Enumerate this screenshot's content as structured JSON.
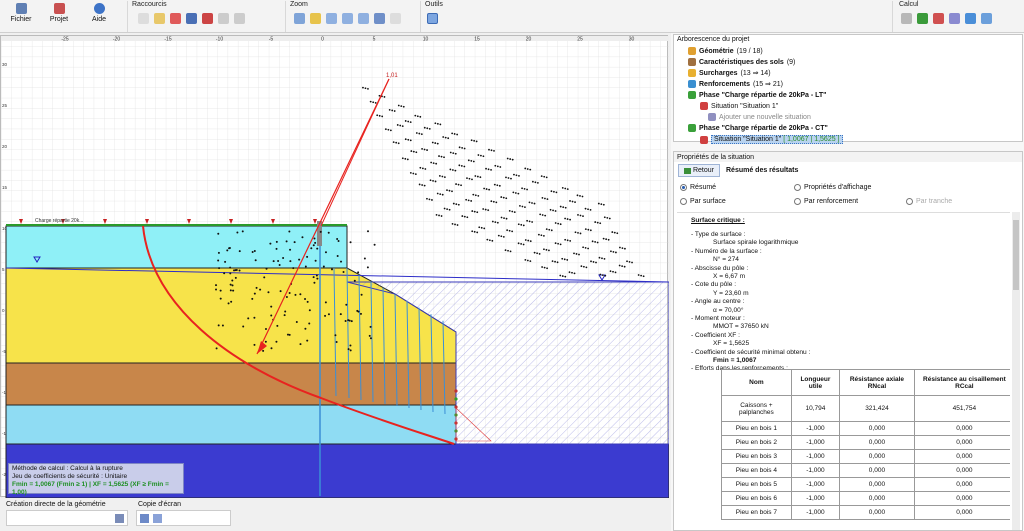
{
  "ribbon": {
    "fichier": "Fichier",
    "projet": "Projet",
    "aide": "Aide",
    "raccourcis": "Raccourcis",
    "zoom": "Zoom",
    "outils": "Outils",
    "calcul": "Calcul"
  },
  "canvas": {
    "axis_ticks": [
      "-25",
      "-20",
      "-15",
      "-10",
      "-5",
      "0",
      "5",
      "10",
      "15",
      "20",
      "25",
      "30"
    ],
    "left_ticks": [
      "30",
      "25",
      "20",
      "15",
      "10",
      "5",
      "0",
      "-5",
      "-10",
      "-15",
      "-20"
    ],
    "f_label": "1,01",
    "load_label": "Charge répartie 20k..."
  },
  "info": {
    "line1": "Méthode de calcul : Calcul à la rupture",
    "line2": "Jeu de coefficients de sécurité : Unitaire",
    "line3": "Fmin = 1,0067 (Fmin ≥ 1)  |  XF = 1,5625 (XF ≥ Fmin = 1,00)"
  },
  "bottom": {
    "creation": "Création directe de la géométrie",
    "copie": "Copie d'écran"
  },
  "tree": {
    "title": "Arborescence du projet",
    "items": [
      {
        "label": "Géométrie",
        "extra": " (19 / 18)"
      },
      {
        "label": "Caractéristiques des sols",
        "extra": " (9)"
      },
      {
        "label": "Surcharges",
        "extra": " (13 ⇒ 14)"
      },
      {
        "label": "Renforcements",
        "extra": " (15 ⇒ 21)"
      },
      {
        "label": "Phase \"Charge répartie de 20kPa - LT\"",
        "extra": ""
      },
      {
        "label": "Situation \"Situation 1\"",
        "extra": ""
      },
      {
        "label": "Ajouter une nouvelle situation",
        "extra": ""
      },
      {
        "label": "Phase \"Charge répartie de 20kPa - CT\"",
        "extra": ""
      },
      {
        "label": "Situation \"Situation 1\"",
        "extra": " [ 1,0067 | 1,5625 ]"
      }
    ]
  },
  "props": {
    "title": "Propriétés de la situation",
    "back": "Retour",
    "summary_title": "Résumé des résultats",
    "radios": [
      "Résumé",
      "Propriétés d'affichage",
      "Par surface",
      "Par renforcement",
      "Par tranche"
    ],
    "section": "Surface critique :",
    "lines": [
      "- Type de surface :",
      "Surface spirale logarithmique",
      "- Numéro de la surface :",
      "N° = 274",
      "- Abscisse du pôle :",
      "X = 6,67 m",
      "- Cote du pôle :",
      "Y = 23,60 m",
      "- Angle au centre :",
      "α = 70,00°",
      "- Moment moteur :",
      "MMOT = 37650 kN",
      "- Coefficient XF :",
      "XF = 1,5625",
      "- Coefficient de sécurité minimal obtenu :",
      "Fmin = 1,0067",
      "- Efforts dans les renforcements :"
    ],
    "table_headers": [
      "Nom",
      "Longueur utile",
      "Résistance axiale RNcal",
      "Résistance au cisaillement RCcal"
    ],
    "table_rows": [
      [
        "Caissons + palplanches",
        "10,794",
        "321,424",
        "451,754"
      ],
      [
        "Pieu en bois 1",
        "-1,000",
        "0,000",
        "0,000"
      ],
      [
        "Pieu en bois 2",
        "-1,000",
        "0,000",
        "0,000"
      ],
      [
        "Pieu en bois 3",
        "-1,000",
        "0,000",
        "0,000"
      ],
      [
        "Pieu en bois 4",
        "-1,000",
        "0,000",
        "0,000"
      ],
      [
        "Pieu en bois 5",
        "-1,000",
        "0,000",
        "0,000"
      ],
      [
        "Pieu en bois 6",
        "-1,000",
        "0,000",
        "0,000"
      ],
      [
        "Pieu en bois 7",
        "-1,000",
        "0,000",
        "0,000"
      ]
    ]
  },
  "colors": {
    "layer1": "#8ff0f7",
    "layer2": "#f7e34a",
    "layer3": "#c8864a",
    "layer4": "#8fdcf3",
    "layer5": "#3b3bd0",
    "critical": "#e8231f",
    "piles": "#3b8fd6"
  }
}
